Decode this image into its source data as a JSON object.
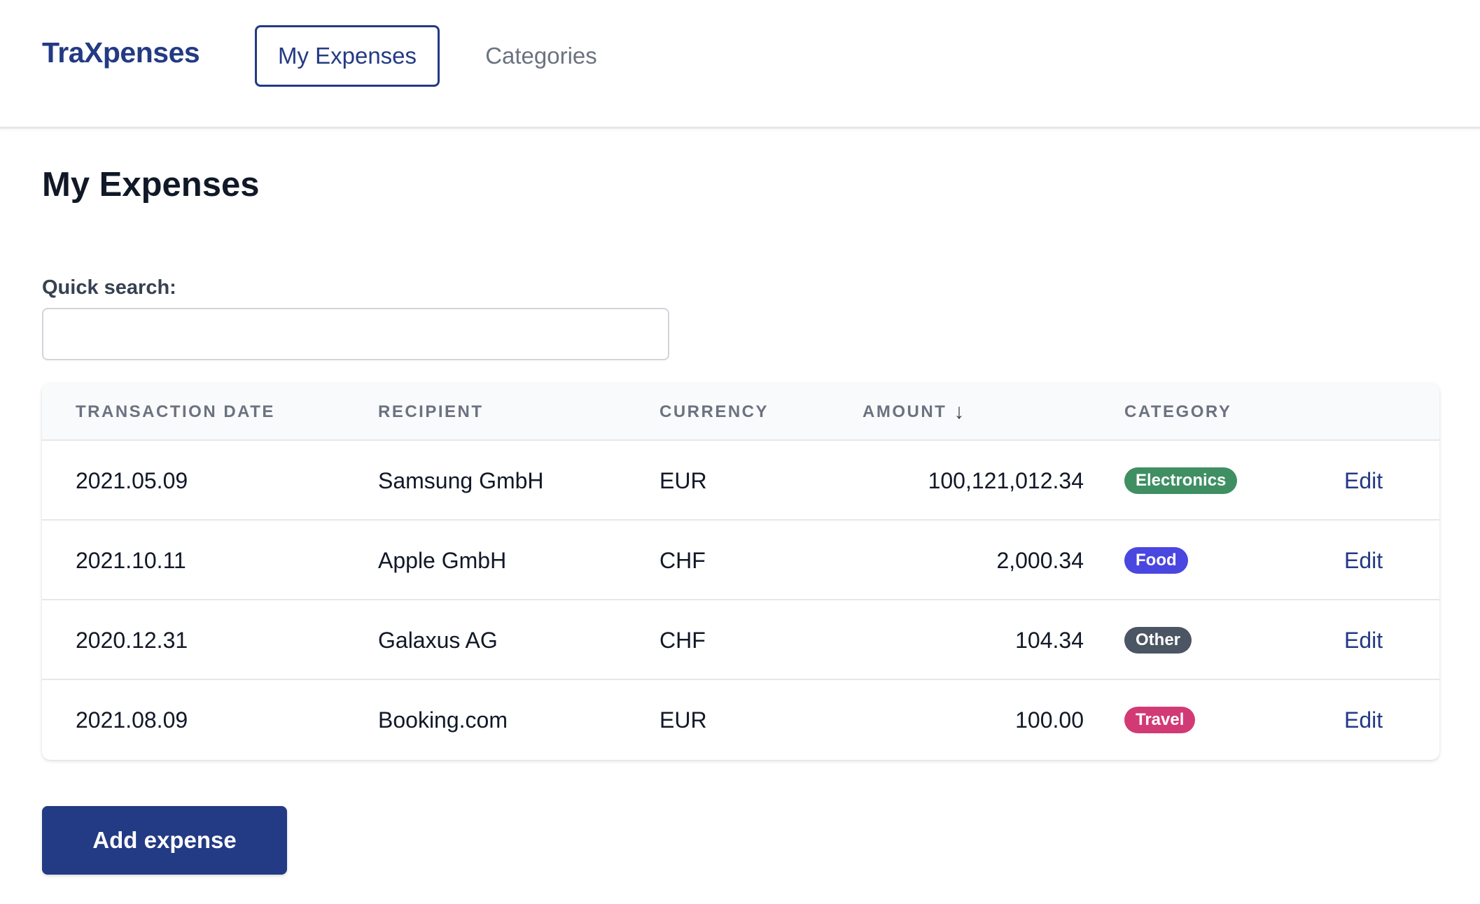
{
  "app": {
    "brand": "TraXpenses"
  },
  "nav": {
    "tabs": [
      {
        "label": "My Expenses",
        "active": true
      },
      {
        "label": "Categories",
        "active": false
      }
    ]
  },
  "page": {
    "title": "My Expenses"
  },
  "search": {
    "label": "Quick search:",
    "value": "",
    "placeholder": ""
  },
  "table": {
    "columns": [
      "TRANSACTION DATE",
      "RECIPIENT",
      "CURRENCY",
      "AMOUNT",
      "CATEGORY"
    ],
    "sort": {
      "column": "AMOUNT",
      "direction": "descending",
      "icon": "arrow-down-icon"
    },
    "rows": [
      {
        "date": "2021.05.09",
        "recipient": "Samsung GmbH",
        "currency": "EUR",
        "amount": "100,121,012.34",
        "category": "Electronics",
        "category_color": "#3f8f63",
        "action": "Edit"
      },
      {
        "date": "2021.10.11",
        "recipient": "Apple GmbH",
        "currency": "CHF",
        "amount": "2,000.34",
        "category": "Food",
        "category_color": "#4a46e0",
        "action": "Edit"
      },
      {
        "date": "2020.12.31",
        "recipient": "Galaxus AG",
        "currency": "CHF",
        "amount": "104.34",
        "category": "Other",
        "category_color": "#4b5563",
        "action": "Edit"
      },
      {
        "date": "2021.08.09",
        "recipient": "Booking.com",
        "currency": "EUR",
        "amount": "100.00",
        "category": "Travel",
        "category_color": "#d23a75",
        "action": "Edit"
      }
    ]
  },
  "actions": {
    "add_label": "Add expense"
  },
  "colors": {
    "accent": "#233a84",
    "muted_text": "#6b7280",
    "header_bg": "#f9fafb"
  }
}
